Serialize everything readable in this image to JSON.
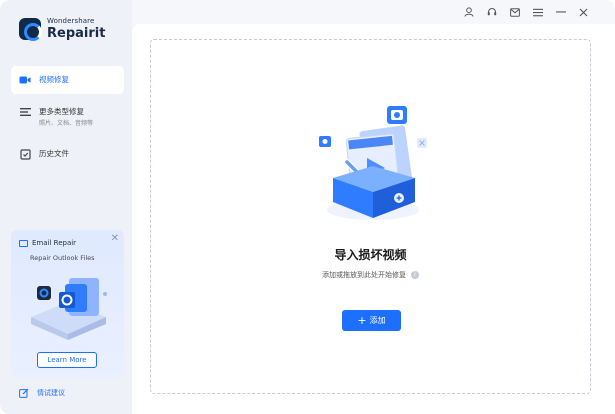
{
  "app": {
    "brand_line1": "Wondershare",
    "brand_line2": "Repairit"
  },
  "sidebar": {
    "items": [
      {
        "label": "视频修复",
        "sub": "",
        "active": true,
        "icon": "video-icon"
      },
      {
        "label": "更多类型修复",
        "sub": "照片、文档、音频等",
        "active": false,
        "icon": "list-icon"
      },
      {
        "label": "历史文件",
        "sub": "",
        "active": false,
        "icon": "history-icon"
      }
    ]
  },
  "promo": {
    "title": "Email Repair",
    "subtitle": "Repair Outlook Files",
    "button": "Learn More",
    "close": "✕"
  },
  "feedback": {
    "label": "情试建议"
  },
  "main": {
    "title": "导入损坏视频",
    "hint": "添加或拖放到此处开始修复",
    "info": "i",
    "add_button": "添加",
    "add_plus": "+"
  },
  "colors": {
    "accent": "#1d6fff",
    "sidebar_bg": "#eef2f8",
    "main_bg": "#ffffff"
  },
  "titlebar_icons": [
    "user-icon",
    "headset-icon",
    "mail-icon",
    "menu-icon",
    "minimize-icon",
    "close-icon"
  ]
}
